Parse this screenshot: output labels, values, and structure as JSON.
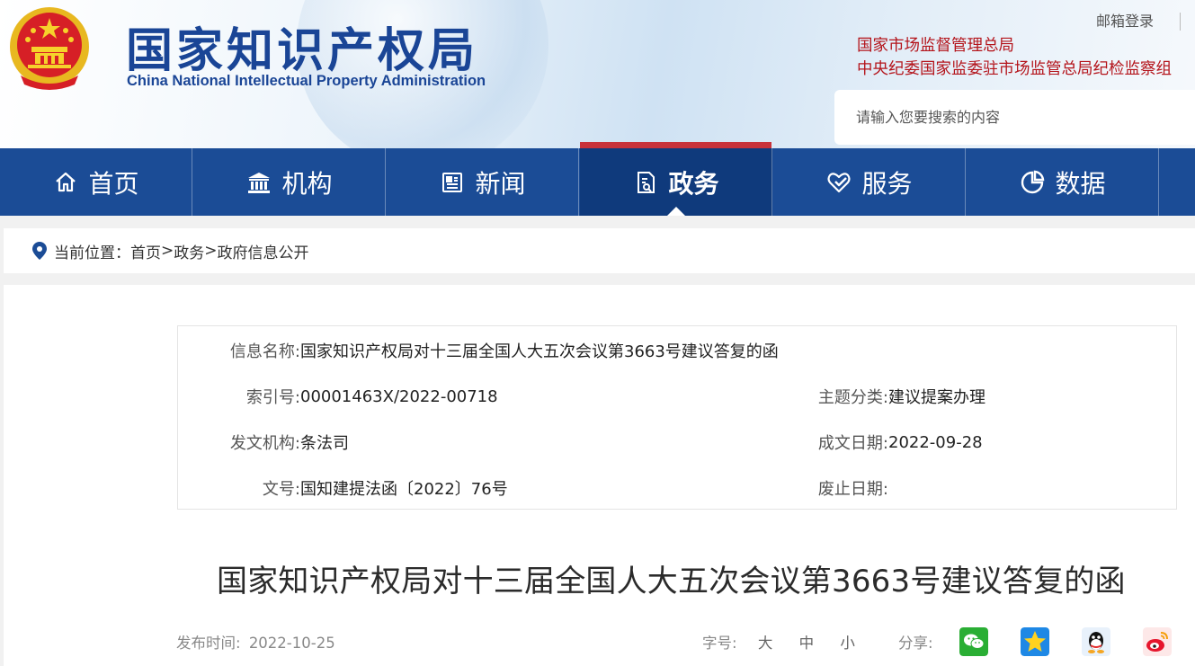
{
  "header": {
    "logo_cn": "国家知识产权局",
    "logo_en": "China National Intellectual Property Administration",
    "mail_login": "邮箱登录",
    "org_links": [
      "国家市场监督管理总局",
      "中央纪委国家监委驻市场监管总局纪检监察组"
    ],
    "search_placeholder": "请输入您要搜索的内容"
  },
  "nav": {
    "items": [
      {
        "label": "首页",
        "icon": "home-icon"
      },
      {
        "label": "机构",
        "icon": "institution-icon"
      },
      {
        "label": "新闻",
        "icon": "news-icon"
      },
      {
        "label": "政务",
        "icon": "government-affairs-icon",
        "active": true
      },
      {
        "label": "服务",
        "icon": "service-icon"
      },
      {
        "label": "数据",
        "icon": "data-pie-icon"
      }
    ]
  },
  "breadcrumb": {
    "prefix": "当前位置：",
    "items": [
      "首页",
      "政务",
      "政府信息公开"
    ],
    "separator": ">"
  },
  "info": {
    "name_label": "信息名称:",
    "name_value": "国家知识产权局对十三届全国人大五次会议第3663号建议答复的函",
    "index_label": "索引号:",
    "index_value": "00001463X/2022-00718",
    "topic_label": "主题分类:",
    "topic_value": "建议提案办理",
    "issuer_label": "发文机构:",
    "issuer_value": "条法司",
    "date_label": "成文日期:",
    "date_value": "2022-09-28",
    "docno_label": "文号:",
    "docno_value": "国知建提法函〔2022〕76号",
    "abolish_label": "废止日期:",
    "abolish_value": ""
  },
  "article": {
    "title": "国家知识产权局对十三届全国人大五次会议第3663号建议答复的函",
    "publish_label": "发布时间:",
    "publish_date": "2022-10-25",
    "font_size_label": "字号:",
    "font_sizes": [
      "大",
      "中",
      "小"
    ],
    "share_label": "分享:",
    "share_icons": [
      "wechat-icon",
      "qzone-icon",
      "qq-icon",
      "weibo-icon"
    ]
  },
  "colors": {
    "nav_bg": "#1b4c96",
    "nav_active_bg": "#0f3a7c",
    "nav_active_bar": "#c8323a",
    "logo_blue": "#1a4596",
    "org_link_red": "#b4141b"
  }
}
